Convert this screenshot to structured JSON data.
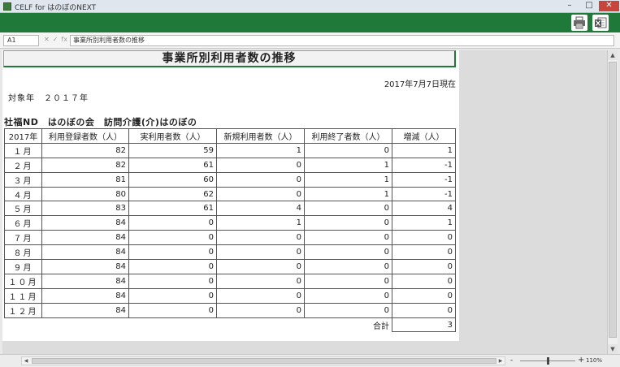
{
  "window": {
    "title": "CELF for はのぼのNEXT",
    "minimize": "–",
    "maximize": "□",
    "close": "✕"
  },
  "toolbar": {
    "icons": [
      "printer-icon",
      "excel-export-icon"
    ],
    "accent_color": "#1f7a3a"
  },
  "formula_bar": {
    "name_box": "A1",
    "cancel_glyph": "✕",
    "confirm_glyph": "✓",
    "fx_glyph": "fx",
    "formula": "事業所別利用者数の推移"
  },
  "report": {
    "title": "事業所別利用者数の推移",
    "date": "2017年7月7日現在",
    "target_year": "対象年　２０１７年",
    "facility": "社福ND　はのぼの会　訪問介護(介)はのぼの",
    "columns": [
      "2017年",
      "利用登録者数（人）",
      "実利用者数（人）",
      "新規利用者数（人）",
      "利用終了者数（人）",
      "増減（人）"
    ],
    "rows": [
      {
        "month": "１月",
        "registered": "82",
        "actual": "59",
        "new": "1",
        "ended": "0",
        "change": "1"
      },
      {
        "month": "２月",
        "registered": "82",
        "actual": "61",
        "new": "0",
        "ended": "1",
        "change": "-1"
      },
      {
        "month": "３月",
        "registered": "81",
        "actual": "60",
        "new": "0",
        "ended": "1",
        "change": "-1"
      },
      {
        "month": "４月",
        "registered": "80",
        "actual": "62",
        "new": "0",
        "ended": "1",
        "change": "-1"
      },
      {
        "month": "５月",
        "registered": "83",
        "actual": "61",
        "new": "4",
        "ended": "0",
        "change": "4"
      },
      {
        "month": "６月",
        "registered": "84",
        "actual": "0",
        "new": "1",
        "ended": "0",
        "change": "1"
      },
      {
        "month": "７月",
        "registered": "84",
        "actual": "0",
        "new": "0",
        "ended": "0",
        "change": "0"
      },
      {
        "month": "８月",
        "registered": "84",
        "actual": "0",
        "new": "0",
        "ended": "0",
        "change": "0"
      },
      {
        "month": "９月",
        "registered": "84",
        "actual": "0",
        "new": "0",
        "ended": "0",
        "change": "0"
      },
      {
        "month": "１０月",
        "registered": "84",
        "actual": "0",
        "new": "0",
        "ended": "0",
        "change": "0"
      },
      {
        "month": "１１月",
        "registered": "84",
        "actual": "0",
        "new": "0",
        "ended": "0",
        "change": "0"
      },
      {
        "month": "１２月",
        "registered": "84",
        "actual": "0",
        "new": "0",
        "ended": "0",
        "change": "0"
      }
    ],
    "total_label": "合計",
    "total_value": "3"
  },
  "statusbar": {
    "zoom_minus": "-",
    "zoom_plus": "+",
    "zoom_level": "110%"
  }
}
